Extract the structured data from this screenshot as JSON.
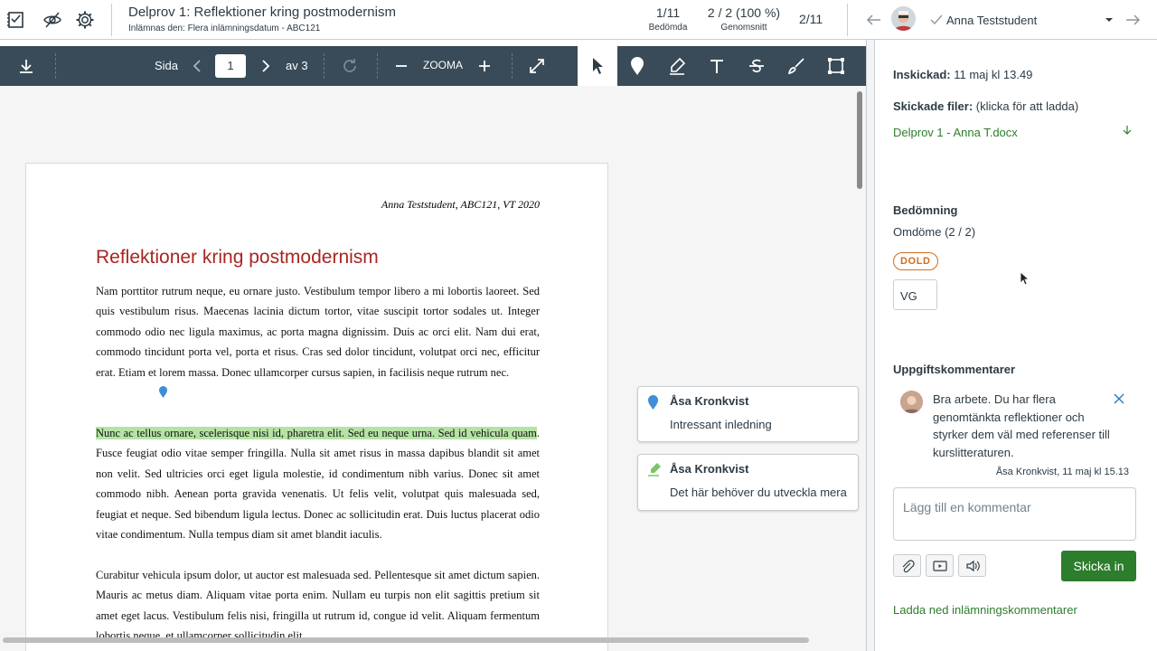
{
  "header": {
    "title": "Delprov 1: Reflektioner kring postmodernism",
    "subtitle": "Inlämnas den: Flera inlämningsdatum - ABC121",
    "graded_value": "1/11",
    "graded_label": "Bedömda",
    "average_value": "2 / 2 (100 %)",
    "average_label": "Genomsnitt",
    "position": "2/11",
    "student_name": "Anna Teststudent"
  },
  "toolbar": {
    "page_label": "Sida",
    "page_value": "1",
    "page_of": "av 3",
    "zoom_label": "ZOOMA"
  },
  "document": {
    "header_line": "Anna Teststudent, ABC121, VT 2020",
    "title": "Reflektioner kring postmodernism",
    "para1": "Nam porttitor rutrum neque, eu ornare justo. Vestibulum tempor libero a mi lobortis laoreet. Sed quis vestibulum risus. Maecenas lacinia dictum tortor, vitae suscipit tortor sodales ut. Integer commodo odio nec ligula maximus, ac porta magna dignissim. Duis ac orci elit. Nam dui erat, commodo tincidunt porta vel, porta et risus. Cras sed dolor tincidunt, volutpat orci nec, efficitur erat. Etiam et lorem massa. Donec ullamcorper cursus sapien, in facilisis neque rutrum nec.",
    "para2_highlight": "Nunc ac tellus ornare, scelerisque nisi id, pharetra elit. Sed eu neque urna. Sed id vehicula quam",
    "para2_rest": ". Fusce feugiat odio vitae semper fringilla. Nulla sit amet risus in massa dapibus blandit sit amet non velit. Sed ultricies orci eget ligula molestie, id condimentum nibh varius. Donec sit amet commodo nibh. Aenean porta gravida venenatis. Ut felis velit, volutpat quis malesuada sed, feugiat et neque. Sed bibendum ligula lectus. Donec ac sollicitudin erat. Duis luctus placerat odio vitae condimentum. Nulla tempus diam sit amet blandit iaculis.",
    "para3": "Curabitur vehicula ipsum dolor, ut auctor est malesuada sed. Pellentesque sit amet dictum sapien. Mauris ac metus diam. Aliquam vitae porta enim. Nullam eu turpis non elit sagittis pretium sit amet eget lacus. Vestibulum felis nisi, fringilla ut rutrum id, congue id velit. Aliquam fermentum lobortis neque, et ullamcorper sollicitudin elit."
  },
  "annotations": [
    {
      "author": "Åsa Kronkvist",
      "text": "Intressant inledning",
      "icon": "pin-icon"
    },
    {
      "author": "Åsa Kronkvist",
      "text": "Det här behöver du utveckla mera",
      "icon": "highlighter-icon"
    }
  ],
  "sidebar": {
    "submitted_label": "Inskickad:",
    "submitted_value": "11 maj kl 13.49",
    "files_label": "Skickade filer:",
    "files_hint": "(klicka för att ladda)",
    "file_name": "Delprov 1 - Anna T.docx",
    "grading_heading": "Bedömning",
    "grading_detail": "Omdöme (2 / 2)",
    "hidden_badge": "DOLD",
    "grade_value": "VG",
    "comments_heading": "Uppgiftskommentarer",
    "comment_text": "Bra arbete. Du har flera genomtänkta reflektioner och styrker dem väl med referenser till kurslitteraturen.",
    "comment_meta": "Åsa Kronkvist, 11 maj kl 15.13",
    "comment_placeholder": "Lägg till en kommentar",
    "submit_label": "Skicka in",
    "download_comments": "Ladda ned inlämningskommentarer"
  },
  "colors": {
    "toolbar_bg": "#394b58",
    "title_red": "#a82621",
    "link_green": "#2c7d2c",
    "highlight": "#b5e3a5",
    "badge_orange": "#cf6d1e",
    "pin_blue": "#3f8fd8"
  }
}
